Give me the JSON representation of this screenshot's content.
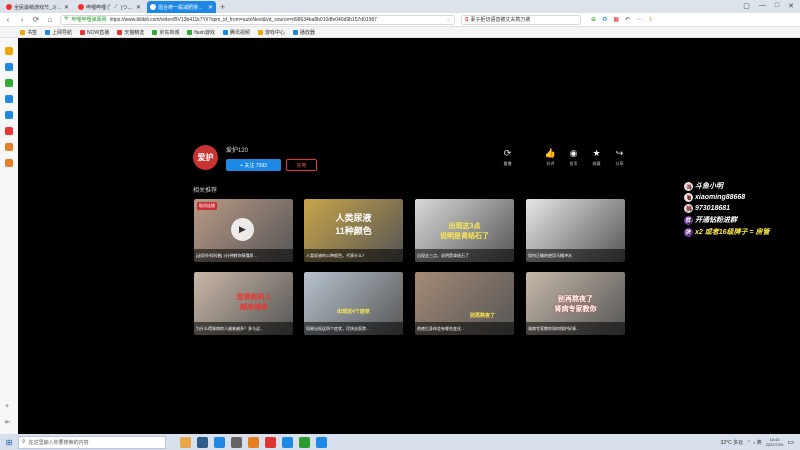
{
  "browser": {
    "tabs": [
      {
        "title": "全民最萌游戏节_斗鱼直播平台",
        "active": false
      },
      {
        "title": "哔哩哔哩 (゜-゜)つロ 干杯~-bilibili",
        "active": false
      },
      {
        "title": "混合痔一般减肥排尿 出钟血的原因",
        "active": true
      }
    ],
    "new_tab": "+",
    "window_controls": [
      "▢",
      "—",
      "□",
      "✕"
    ],
    "nav": {
      "back": "‹",
      "forward": "›",
      "refresh": "⟳",
      "home": "⌂"
    },
    "address": {
      "safe_label": "哔哩哔哩弹幕网",
      "url": "https://www.bilibili.com/video/BV13b411k7Yi/?spm_id_from=autoNext&vd_source=d98634ba8b010dfe040d9b157d01987",
      "star": "☆"
    },
    "search": {
      "engine": "S",
      "text": "妻子拒切语音被丈夫携刀袭"
    },
    "tools": [
      "⊕",
      "♻",
      "▦",
      "↶",
      "⋯",
      "⇩"
    ],
    "bookmarks": [
      "书签",
      "上网导航",
      "NOW直播",
      "天猫精选",
      "京东商城",
      "flash游戏",
      "腾讯视频",
      "游戏中心",
      "播放器"
    ]
  },
  "video_page": {
    "author": {
      "avatar_text": "爱护",
      "name": "爱护120",
      "follow_label": "+ 关注 7993",
      "charge_label": "充电"
    },
    "actions": [
      {
        "icon": "⟳",
        "label": "重播"
      },
      {
        "icon": "👍",
        "label": "好评"
      },
      {
        "icon": "◉",
        "label": "投币"
      },
      {
        "icon": "★",
        "label": "收藏"
      },
      {
        "icon": "↪",
        "label": "分享"
      }
    ],
    "related_title": "相关推荐",
    "cards": [
      {
        "tag": "取消连播",
        "overlay": "",
        "title": "[泌尿外科科普] 3分钟教你搞懂尿...",
        "color": "#b99a86",
        "play": "▶"
      },
      {
        "tag": "",
        "overlay": "人类尿液\n11种颜色",
        "title": "人类尿液的11种颜色，代表什么？",
        "color": "#c8a44a",
        "play": ""
      },
      {
        "tag": "",
        "overlay": "出现这3点\n说明是肾结石了",
        "title": "出现这三点，说明是肾结石了",
        "color": "#d9d9d9",
        "play": ""
      },
      {
        "tag": "",
        "overlay": "",
        "title": "如何正确的使用马桶冲水",
        "color": "#e6e6e6",
        "play": ""
      },
      {
        "tag": "",
        "overlay": "患肾病的人\n越来越多",
        "title": "为什么得肾病的人越来越多？多与这...",
        "color": "#c9b7a6",
        "play": ""
      },
      {
        "tag": "",
        "overlay": "出现这4个症状",
        "title": "如果出现这四个症状，尽快去医院...",
        "color": "#b7c3cf",
        "play": ""
      },
      {
        "tag": "",
        "overlay": "别再熬夜了",
        "title": "熬夜后身体会有哪些变化...",
        "color": "#a48b76",
        "play": ""
      },
      {
        "tag": "",
        "overlay": "别再熬夜了\n肾病专家教你",
        "title": "肾病专家教你如何保护好肾...",
        "color": "#c6b8a8",
        "play": ""
      }
    ]
  },
  "stream_overlay": [
    {
      "icon": "斗",
      "text": "斗鱼小明"
    },
    {
      "icon": "B",
      "text": "xiaoming88668"
    },
    {
      "icon": "抖",
      "text": "973018681"
    },
    {
      "icon": "群",
      "text": "开通钻粉进群"
    },
    {
      "icon": "牌",
      "text": "x2 或者16级牌子 = 房管"
    }
  ],
  "taskbar": {
    "start_icon": "⊞",
    "search_placeholder": "在这里输入你要搜索的内容",
    "weather": "32°C 多云",
    "tray_icons": "⌃  ♪  英",
    "time": "18:43",
    "date": "2022/7/29",
    "notification": "▭"
  }
}
